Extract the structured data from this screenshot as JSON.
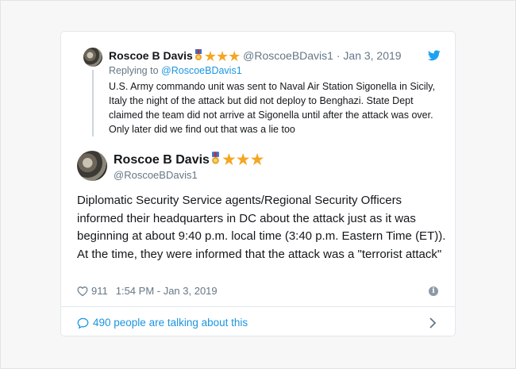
{
  "parent_tweet": {
    "name": "Roscoe B Davis",
    "handle": "@RoscoeBDavis1",
    "separator": "·",
    "date": "Jan 3, 2019",
    "replying_label": "Replying to",
    "replying_handle": "@RoscoeBDavis1",
    "text": "U.S. Army commando unit was sent to Naval Air Station Sigonella in Sicily, Italy the night of the attack but did not deploy to Benghazi. State Dept claimed the team did not arrive at Sigonella until  after the attack was over. Only later did we find out that was a lie too",
    "icons": [
      "medal-icon",
      "star-icon",
      "star-icon",
      "star-icon",
      "twitter-bird-icon"
    ]
  },
  "main_tweet": {
    "name": "Roscoe B Davis",
    "handle": "@RoscoeBDavis1",
    "text": "Diplomatic Security Service agents/Regional Security Officers informed their headquarters in DC about the attack just as it was beginning at about 9:40 p.m. local time (3:40 p.m. Eastern Time (ET)). At the time, they were informed that the attack was a \"terrorist  attack\"",
    "likes": "911",
    "timestamp": "1:54 PM - Jan 3, 2019",
    "icons": [
      "medal-icon",
      "star-icon",
      "star-icon",
      "star-icon",
      "heart-icon",
      "info-icon"
    ]
  },
  "footer": {
    "talking_label": "490 people are talking about this",
    "icons": [
      "comment-bubble-icon",
      "chevron-right-icon"
    ]
  },
  "colors": {
    "link_blue": "#1b95e0",
    "muted_gray": "#657786",
    "star_gold": "#f5a623",
    "text_dark": "#14171a"
  }
}
